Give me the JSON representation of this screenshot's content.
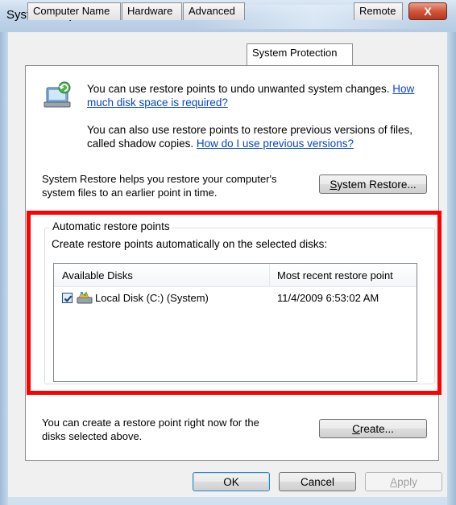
{
  "window": {
    "title": "System Properties",
    "close_glyph": "X"
  },
  "tabs": [
    {
      "label": "Computer Name",
      "active": false
    },
    {
      "label": "Hardware",
      "active": false
    },
    {
      "label": "Advanced",
      "active": false
    },
    {
      "label": "System Protection",
      "active": true
    },
    {
      "label": "Remote",
      "active": false
    }
  ],
  "intro": {
    "line1_text": "You can use restore points to undo unwanted system changes.",
    "link1_part1": "How",
    "link1_part2": "much disk space is required?",
    "line2_text": "You can also use restore points to restore previous versions of files,",
    "line3_text": "called shadow copies.",
    "link2": "How do I use previous versions?"
  },
  "restore": {
    "line1": "System Restore helps you restore your computer's",
    "line2": "system files to an earlier point in time.",
    "button_underlined": "S",
    "button_rest": "ystem Restore..."
  },
  "auto": {
    "legend": "Automatic restore points",
    "description": "Create restore points automatically on the selected disks:",
    "columns": [
      "Available Disks",
      "Most recent restore point"
    ],
    "rows": [
      {
        "disk": "Local Disk (C:) (System)",
        "last_restore": "11/4/2009 6:53:02 AM",
        "checked": true
      }
    ]
  },
  "create": {
    "line1": "You can create a restore point right now for the",
    "line2": "disks selected above.",
    "button_underlined": "C",
    "button_rest": "reate..."
  },
  "footer": {
    "ok": "OK",
    "cancel": "Cancel",
    "apply_underlined": "A",
    "apply_rest": "pply"
  },
  "colors": {
    "link": "#0645c8",
    "highlight_border": "#ff0000",
    "close_button": "#c8462a"
  }
}
